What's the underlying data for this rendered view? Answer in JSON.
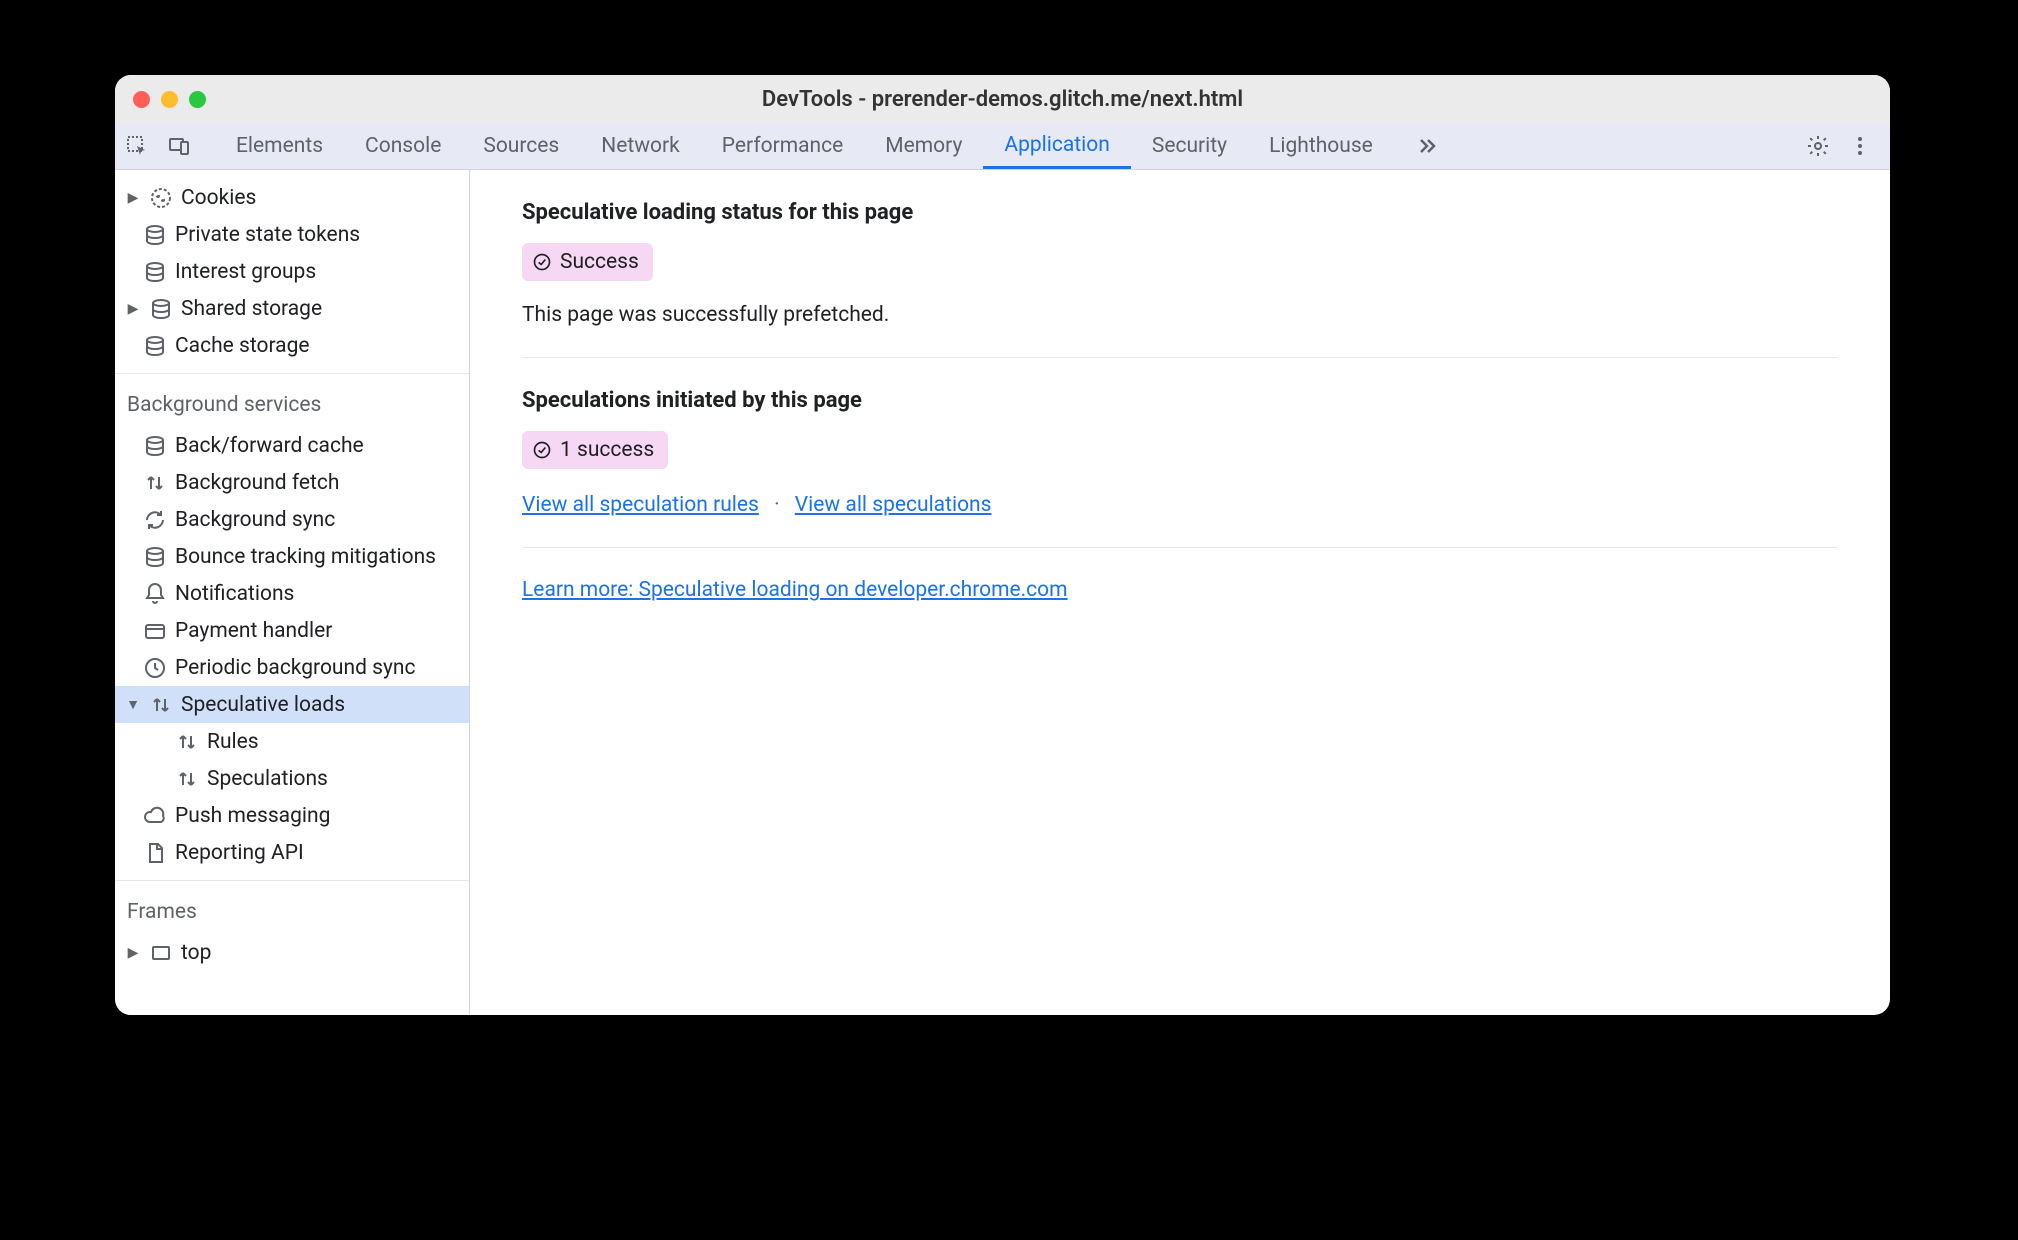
{
  "window": {
    "title": "DevTools - prerender-demos.glitch.me/next.html"
  },
  "tabs": {
    "items": [
      "Elements",
      "Console",
      "Sources",
      "Network",
      "Performance",
      "Memory",
      "Application",
      "Security",
      "Lighthouse"
    ],
    "active": "Application"
  },
  "sidebar": {
    "storage": {
      "items": [
        {
          "label": "Cookies",
          "icon": "cookie",
          "arrow": true
        },
        {
          "label": "Private state tokens",
          "icon": "db"
        },
        {
          "label": "Interest groups",
          "icon": "db"
        },
        {
          "label": "Shared storage",
          "icon": "db",
          "arrow": true
        },
        {
          "label": "Cache storage",
          "icon": "db"
        }
      ]
    },
    "bg": {
      "header": "Background services",
      "items": [
        {
          "label": "Back/forward cache",
          "icon": "db"
        },
        {
          "label": "Background fetch",
          "icon": "updown"
        },
        {
          "label": "Background sync",
          "icon": "sync"
        },
        {
          "label": "Bounce tracking mitigations",
          "icon": "db"
        },
        {
          "label": "Notifications",
          "icon": "bell"
        },
        {
          "label": "Payment handler",
          "icon": "card"
        },
        {
          "label": "Periodic background sync",
          "icon": "clock"
        },
        {
          "label": "Speculative loads",
          "icon": "updown",
          "arrow": true,
          "expanded": true,
          "selected": true
        },
        {
          "label": "Rules",
          "icon": "updown",
          "indent": 2
        },
        {
          "label": "Speculations",
          "icon": "updown",
          "indent": 2
        },
        {
          "label": "Push messaging",
          "icon": "cloud"
        },
        {
          "label": "Reporting API",
          "icon": "doc"
        }
      ]
    },
    "frames": {
      "header": "Frames",
      "items": [
        {
          "label": "top",
          "icon": "frame",
          "arrow": true
        }
      ]
    }
  },
  "main": {
    "section1": {
      "heading": "Speculative loading status for this page",
      "badge": "Success",
      "text": "This page was successfully prefetched."
    },
    "section2": {
      "heading": "Speculations initiated by this page",
      "badge": "1 success",
      "link1": "View all speculation rules",
      "link2": "View all speculations"
    },
    "learn_more": "Learn more: Speculative loading on developer.chrome.com"
  }
}
